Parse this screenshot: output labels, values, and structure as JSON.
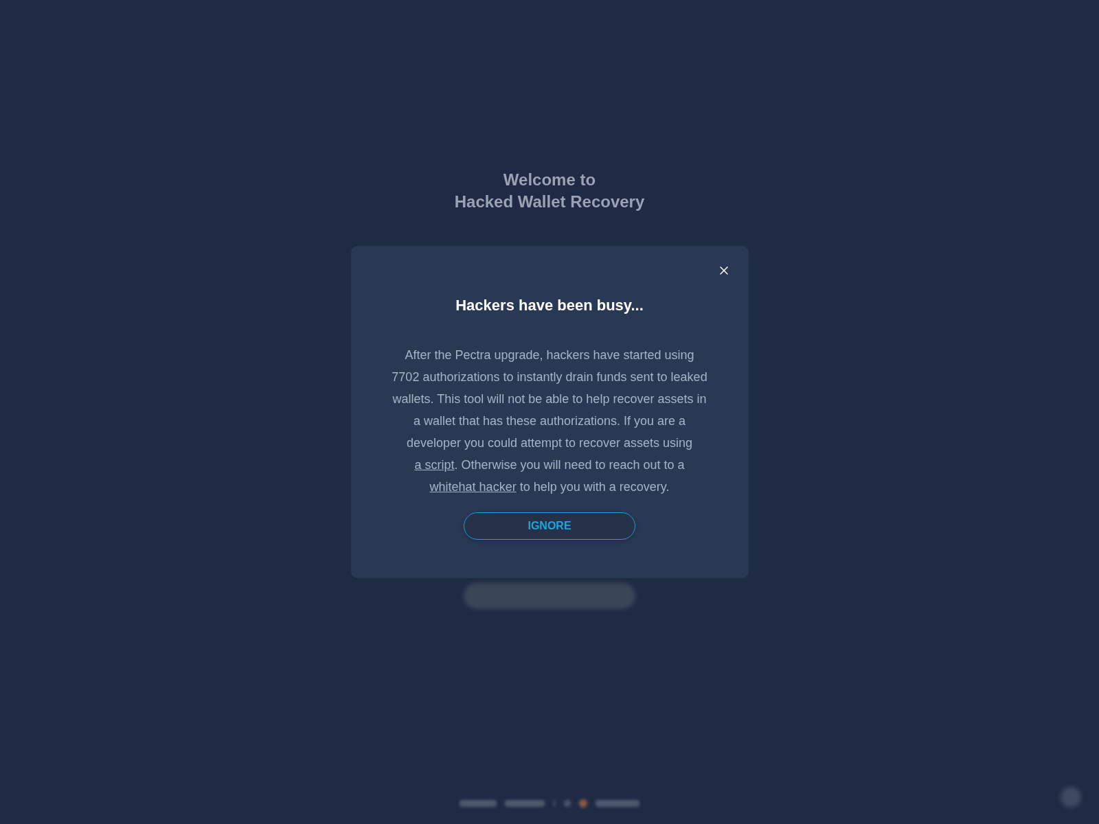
{
  "background": {
    "heading_lines": [
      "Welcome to",
      "Hacked Wallet Recovery"
    ]
  },
  "modal": {
    "title": "Hackers have been busy...",
    "message": [
      {
        "kind": "text",
        "text": "After the Pectra upgrade, hackers have started using 7702 authorizations to instantly drain funds sent to leaked wallets. This tool will not be able to help recover assets in a wallet that has these authorizations. If you are a developer you could attempt to recover assets using "
      },
      {
        "kind": "link",
        "text": "a script"
      },
      {
        "kind": "text",
        "text": ". Otherwise you will need to reach out to a "
      },
      {
        "kind": "link",
        "text": "whitehat hacker"
      },
      {
        "kind": "text",
        "text": " to help you with a recovery."
      }
    ],
    "button": {
      "label": "IGNORE"
    }
  }
}
